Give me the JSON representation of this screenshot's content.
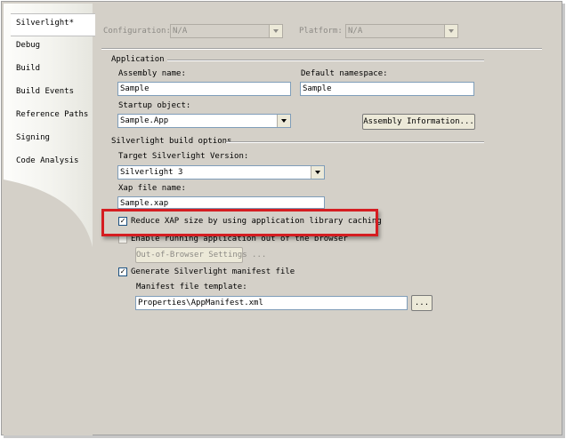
{
  "tabs": {
    "items": [
      {
        "label": "Silverlight*"
      },
      {
        "label": "Debug"
      },
      {
        "label": "Build"
      },
      {
        "label": "Build Events"
      },
      {
        "label": "Reference Paths"
      },
      {
        "label": "Signing"
      },
      {
        "label": "Code Analysis"
      }
    ]
  },
  "toolbar": {
    "configuration_label": "Configuration:",
    "configuration_value": "N/A",
    "platform_label": "Platform:",
    "platform_value": "N/A"
  },
  "application": {
    "group_label": "Application",
    "assembly_name_label": "Assembly name:",
    "assembly_name_value": "Sample",
    "default_namespace_label": "Default namespace:",
    "default_namespace_value": "Sample",
    "startup_object_label": "Startup object:",
    "startup_object_value": "Sample.App",
    "assembly_info_button": "Assembly Information..."
  },
  "build_options": {
    "group_label": "Silverlight build options",
    "target_version_label": "Target Silverlight Version:",
    "target_version_value": "Silverlight 3",
    "xap_label": "Xap file name:",
    "xap_value": "Sample.xap",
    "reduce_xap_label": "Reduce XAP size by using application library caching",
    "reduce_xap_checked": true,
    "out_of_browser_label": "Enable running application out of the browser",
    "out_of_browser_checked": false,
    "oob_settings_button": "Out-of-Browser Settings ...",
    "generate_manifest_label": "Generate Silverlight manifest file",
    "generate_manifest_checked": true,
    "manifest_template_label": "Manifest file template:",
    "manifest_template_value": "Properties\\AppManifest.xml",
    "browse_button": "..."
  },
  "colors": {
    "highlight": "#d51d21",
    "panel": "#d4d0c8"
  }
}
